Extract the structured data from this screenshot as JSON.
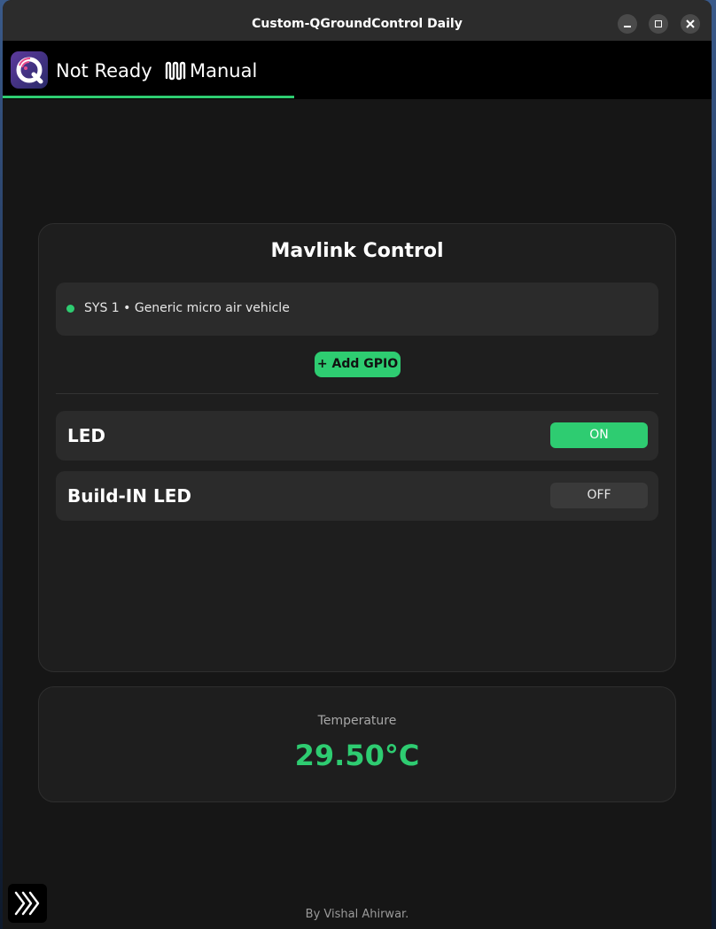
{
  "window": {
    "title": "Custom-QGroundControl Daily",
    "buttons": [
      "minimize",
      "maximize",
      "close"
    ]
  },
  "toolbar": {
    "app_icon": "qgc-logo-icon",
    "status": "Not Ready",
    "mode_icon": "waveform-icon",
    "mode": "Manual",
    "accent_color": "#2ecc71"
  },
  "mavlink_card": {
    "title": "Mavlink Control",
    "vehicle": {
      "status_color": "#2ecc71",
      "label": "SYS 1 • Generic micro air vehicle"
    },
    "add_button_label": "+ Add GPIO",
    "gpios": [
      {
        "name": "LED",
        "state": "ON",
        "on": true
      },
      {
        "name": "Build-IN LED",
        "state": "OFF",
        "on": false
      }
    ]
  },
  "temperature_card": {
    "label": "Temperature",
    "value": "29.50°C",
    "value_color": "#2ecc71"
  },
  "footer": {
    "credit": "By Vishal Ahirwar."
  },
  "expand_button_icon": "triple-chevron-right-icon"
}
